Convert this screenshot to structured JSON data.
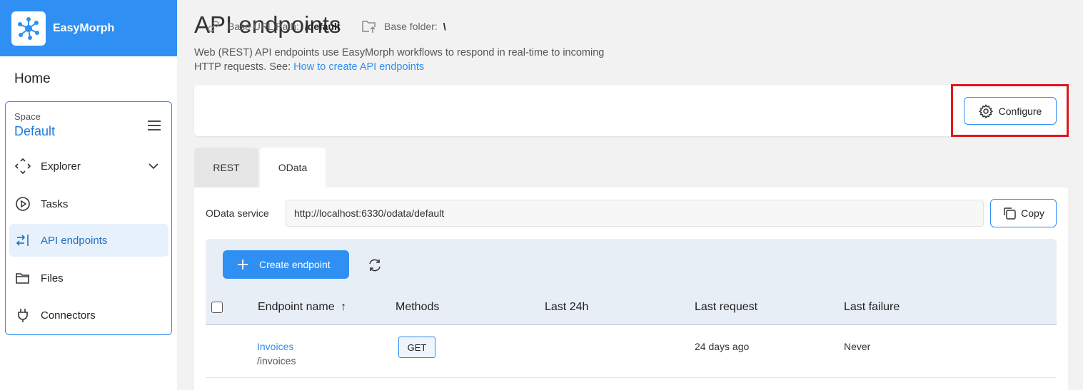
{
  "brand": {
    "name": "EasyMorph"
  },
  "sidebar": {
    "home": "Home",
    "space_label": "Space",
    "space_name": "Default",
    "items": [
      {
        "label": "Explorer",
        "icon": "explorer-icon"
      },
      {
        "label": "Tasks",
        "icon": "play-circle-icon"
      },
      {
        "label": "API endpoints",
        "icon": "arrows-exchange-icon",
        "active": true
      },
      {
        "label": "Files",
        "icon": "folder-icon"
      },
      {
        "label": "Connectors",
        "icon": "plug-icon"
      }
    ]
  },
  "page": {
    "title": "API endpoints",
    "desc_line1": "Web (REST) API endpoints use EasyMorph workflows to respond in real-time to incoming",
    "desc_line2": "HTTP requests. See: ",
    "desc_link": "How to create API endpoints"
  },
  "info": {
    "base_url_label": "Base URL Path:",
    "base_url_value": "/default",
    "base_folder_label": "Base folder:",
    "base_folder_value": "\\",
    "configure_label": "Configure"
  },
  "tabs": [
    {
      "label": "REST"
    },
    {
      "label": "OData",
      "active": true
    }
  ],
  "odata": {
    "label": "OData service",
    "url": "http://localhost:6330/odata/default",
    "copy_label": "Copy"
  },
  "toolbar": {
    "create_label": "Create endpoint"
  },
  "table": {
    "headers": [
      "Endpoint name",
      "Methods",
      "Last 24h",
      "Last request",
      "Last failure"
    ],
    "sort_indicator": "↑",
    "rows": [
      {
        "name": "Invoices",
        "path": "/invoices",
        "method": "GET",
        "last24h": "",
        "last_request": "24 days ago",
        "last_failure": "Never"
      }
    ]
  },
  "colors": {
    "accent": "#2f8ff2",
    "highlight": "#e0161c"
  }
}
